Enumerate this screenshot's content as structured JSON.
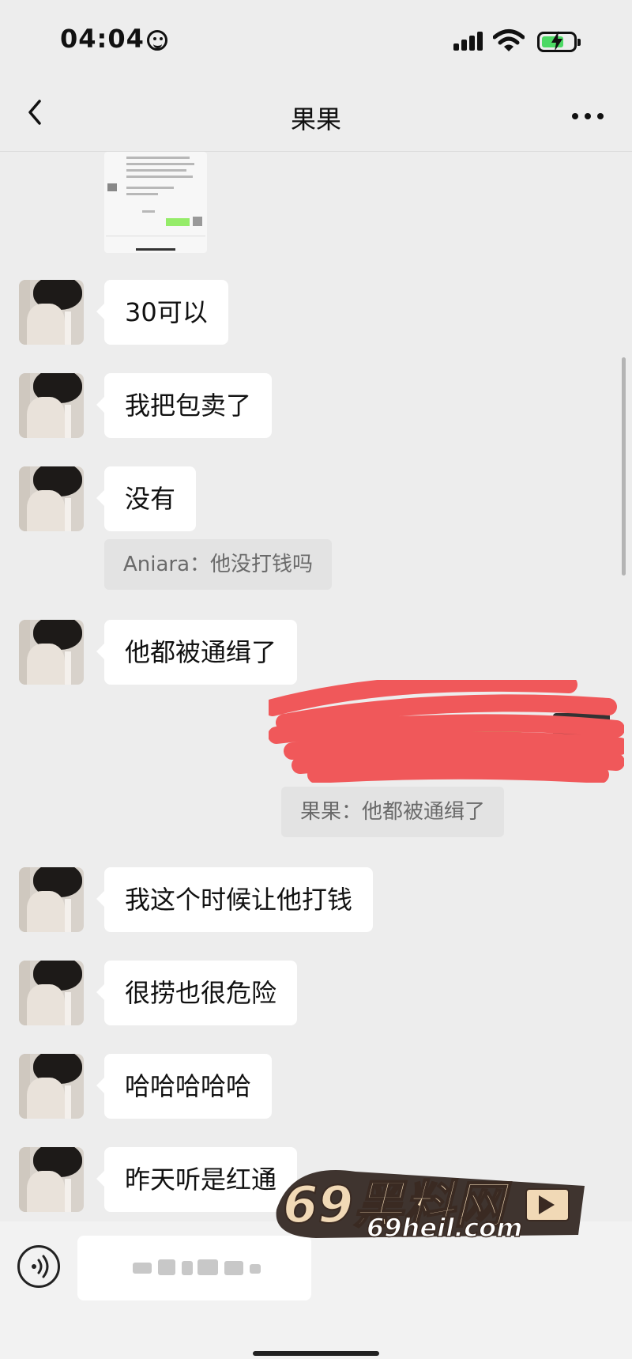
{
  "status_bar": {
    "time": "04:04",
    "icons": [
      "smiley-icon",
      "signal-icon",
      "wifi-icon",
      "battery-charging-icon"
    ],
    "battery_level": 0.7,
    "battery_color": "#4cd964"
  },
  "nav": {
    "title": "果果",
    "back_icon": "chevron-left-icon",
    "more_icon": "more-icon"
  },
  "messages": [
    {
      "text": "30可以"
    },
    {
      "text": "我把包卖了"
    },
    {
      "text": "没有"
    },
    {
      "text": "他都被通缉了"
    },
    {
      "text": "我这个时候让他打钱"
    },
    {
      "text": "很捞也很危险"
    },
    {
      "text": "哈哈哈哈哈"
    },
    {
      "text": "昨天听是红通"
    }
  ],
  "quotes": [
    {
      "text": "Aniara：他没打钱吗"
    },
    {
      "text": "果果：他都被通缉了"
    }
  ],
  "watermark": {
    "line1": "69黑料网",
    "line2": "69heil.com"
  },
  "colors": {
    "background": "#ededed",
    "bubble_incoming": "#ffffff",
    "bubble_outgoing": "#95ec69",
    "redaction": "#f0585a",
    "quote_bg": "#e3e3e3"
  }
}
